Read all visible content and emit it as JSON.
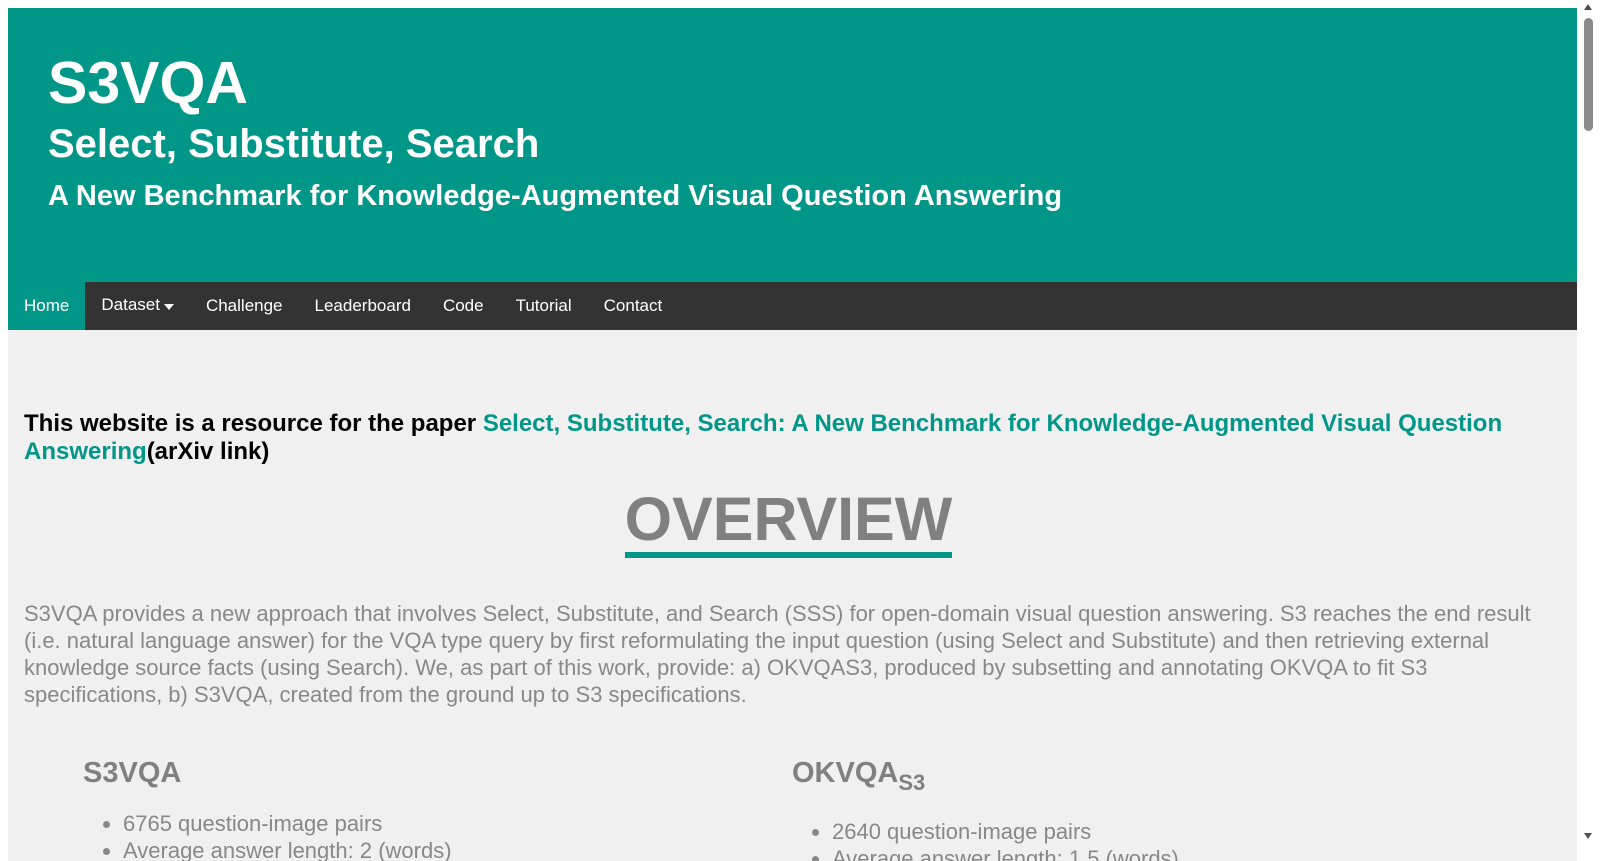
{
  "header": {
    "title": "S3VQA",
    "subtitle": "Select, Substitute, Search",
    "tagline": "A New Benchmark for Knowledge-Augmented Visual Question Answering"
  },
  "nav": {
    "items": [
      {
        "label": "Home"
      },
      {
        "label": "Dataset"
      },
      {
        "label": "Challenge"
      },
      {
        "label": "Leaderboard"
      },
      {
        "label": "Code"
      },
      {
        "label": "Tutorial"
      },
      {
        "label": "Contact"
      }
    ]
  },
  "intro": {
    "prefix": "This website is a resource for the paper ",
    "link_text": "Select, Substitute, Search: A New Benchmark for Knowledge-Augmented Visual Question Answering",
    "suffix": "(arXiv link)"
  },
  "overview": {
    "heading": "OVERVIEW",
    "text": "S3VQA provides a new approach that involves Select, Substitute, and Search (SSS) for open-domain visual question answering. S3 reaches the end result (i.e. natural language answer) for the VQA type query by first reformulating the input question (using Select and Substitute) and then retrieving external knowledge source facts (using Search). We, as part of this work, provide: a) OKVQAS3, produced by subsetting and annotating OKVQA to fit S3 specifications, b) S3VQA, created from the ground up to S3 specifications."
  },
  "datasets": [
    {
      "name": "S3VQA",
      "subscript": "",
      "stats": [
        "6765 question-image pairs",
        "Average answer length: 2 (words)"
      ]
    },
    {
      "name": "OKVQA",
      "subscript": "S3",
      "stats": [
        "2640 question-image pairs",
        "Average answer length: 1.5 (words)"
      ]
    }
  ]
}
